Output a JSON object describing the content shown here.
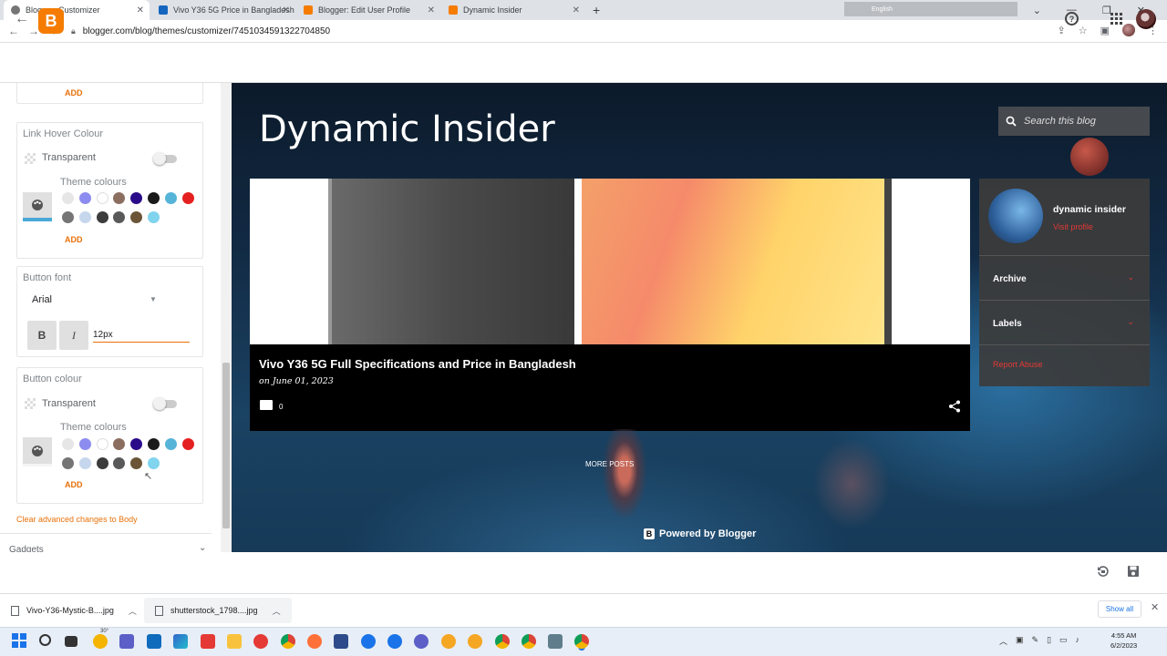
{
  "browser": {
    "tabs": [
      {
        "label": "Blogger: Customizer",
        "active": true,
        "color": "#757575"
      },
      {
        "label": "Vivo Y36 5G Price in Bangladesh",
        "active": false,
        "color": "#1565c0"
      },
      {
        "label": "Blogger: Edit User Profile",
        "active": false,
        "color": "#f57c00"
      },
      {
        "label": "Dynamic Insider",
        "active": false,
        "color": "#f57c00"
      }
    ],
    "url": "blogger.com/blog/themes/customizer/7451034591322704850",
    "lang_indicator": "English"
  },
  "customizer": {
    "add_label": "ADD",
    "link_hover": {
      "title": "Link Hover Colour",
      "transparent_label": "Transparent",
      "theme_colours_label": "Theme colours",
      "add_label": "ADD"
    },
    "button_font": {
      "title": "Button font",
      "font": "Arial",
      "bold": "B",
      "italic": "I",
      "size": "12px"
    },
    "button_colour": {
      "title": "Button colour",
      "transparent_label": "Transparent",
      "theme_colours_label": "Theme colours",
      "add_label": "ADD"
    },
    "clear_label": "Clear advanced changes to Body",
    "gadgets_label": "Gadgets",
    "swatches_row1": [
      "#e6e6e6",
      "#8c8cf0",
      "#ffffff",
      "#8c6e60",
      "#2a0c8a",
      "#1a1a1a",
      "#56b4d8",
      "#e52020"
    ],
    "swatches_row2": [
      "#757575",
      "#c6d6ec",
      "#3c3c3c",
      "#595959",
      "#6b5536",
      "#80d4ee"
    ]
  },
  "preview": {
    "blog_title": "Dynamic Insider",
    "search_placeholder": "Search this blog",
    "post_title": "Vivo Y36 5G Full Specifications and Price in Bangladesh",
    "post_date": "on June 01, 2023",
    "comment_count": "0",
    "more_posts": "MORE POSTS",
    "powered_by": "Powered by Blogger",
    "profile_name": "dynamic insider",
    "visit_profile": "Visit profile",
    "archive_label": "Archive",
    "labels_label": "Labels",
    "report_abuse": "Report Abuse",
    "accent_color": "#e53935"
  },
  "downloads": [
    {
      "name": "Vivo-Y36-Mystic-B....jpg"
    },
    {
      "name": "shutterstock_1798....jpg"
    }
  ],
  "show_all_label": "Show all",
  "taskbar": {
    "weather": "30°",
    "time": "4:55 AM",
    "date": "6/2/2023"
  }
}
